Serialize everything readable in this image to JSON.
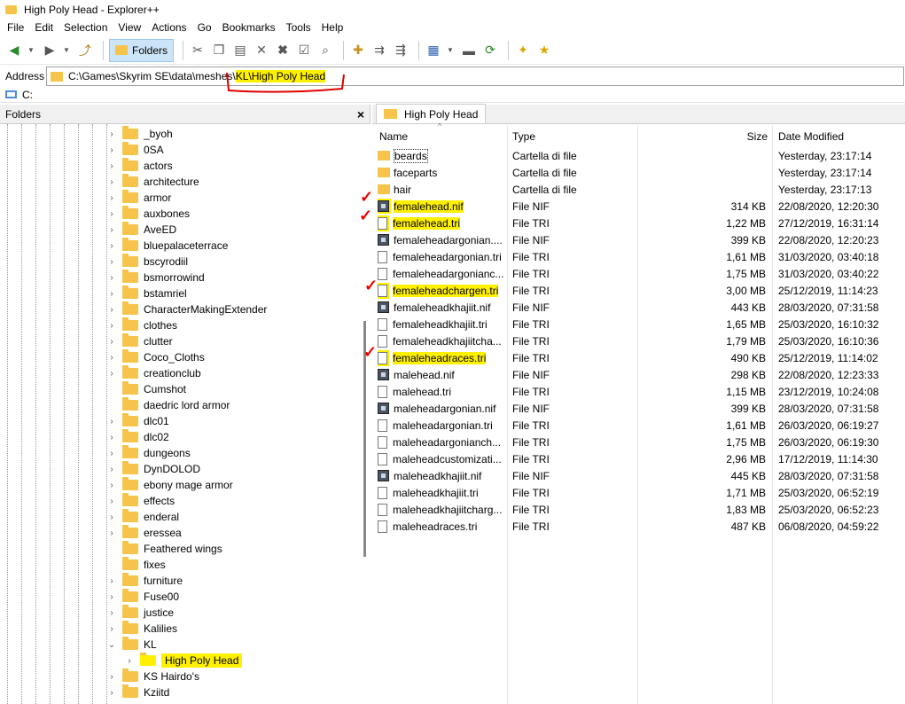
{
  "window": {
    "title": "High Poly Head - Explorer++"
  },
  "menu": [
    "File",
    "Edit",
    "Selection",
    "View",
    "Actions",
    "Go",
    "Bookmarks",
    "Tools",
    "Help"
  ],
  "toolbar": {
    "folders_label": "Folders"
  },
  "address": {
    "label": "Address",
    "path_prefix": "C:\\Games\\Skyrim SE\\data\\meshes\\",
    "path_highlight": "KL\\High Poly Head"
  },
  "drive": {
    "label": "C:"
  },
  "folders_pane": {
    "title": "Folders",
    "close": "×"
  },
  "tree": [
    {
      "label": "_byoh",
      "arrow": "›"
    },
    {
      "label": "0SA",
      "arrow": "›"
    },
    {
      "label": "actors",
      "arrow": "›"
    },
    {
      "label": "architecture",
      "arrow": "›"
    },
    {
      "label": "armor",
      "arrow": "›"
    },
    {
      "label": "auxbones",
      "arrow": "›"
    },
    {
      "label": "AveED",
      "arrow": "›"
    },
    {
      "label": "bluepalaceterrace",
      "arrow": "›"
    },
    {
      "label": "bscyrodiil",
      "arrow": "›"
    },
    {
      "label": "bsmorrowind",
      "arrow": "›"
    },
    {
      "label": "bstamriel",
      "arrow": "›"
    },
    {
      "label": "CharacterMakingExtender",
      "arrow": "›"
    },
    {
      "label": "clothes",
      "arrow": "›"
    },
    {
      "label": "clutter",
      "arrow": "›"
    },
    {
      "label": "Coco_Cloths",
      "arrow": "›"
    },
    {
      "label": "creationclub",
      "arrow": "›"
    },
    {
      "label": "Cumshot",
      "arrow": ""
    },
    {
      "label": "daedric lord armor",
      "arrow": ""
    },
    {
      "label": "dlc01",
      "arrow": "›"
    },
    {
      "label": "dlc02",
      "arrow": "›"
    },
    {
      "label": "dungeons",
      "arrow": "›"
    },
    {
      "label": "DynDOLOD",
      "arrow": "›"
    },
    {
      "label": "ebony mage armor",
      "arrow": "›"
    },
    {
      "label": "effects",
      "arrow": "›"
    },
    {
      "label": "enderal",
      "arrow": "›"
    },
    {
      "label": "eressea",
      "arrow": "›"
    },
    {
      "label": "Feathered wings",
      "arrow": ""
    },
    {
      "label": "fixes",
      "arrow": ""
    },
    {
      "label": "furniture",
      "arrow": "›"
    },
    {
      "label": "Fuse00",
      "arrow": "›"
    },
    {
      "label": "justice",
      "arrow": "›"
    },
    {
      "label": "Kalilies",
      "arrow": "›"
    },
    {
      "label": "KL",
      "arrow": "⌄"
    },
    {
      "label": "High Poly Head",
      "arrow": "›"
    },
    {
      "label": "KS Hairdo's",
      "arrow": "›"
    },
    {
      "label": "Kziitd",
      "arrow": "›"
    }
  ],
  "tab": {
    "label": "High Poly Head"
  },
  "columns": {
    "name": "Name",
    "type": "Type",
    "size": "Size",
    "date": "Date Modified"
  },
  "files": [
    {
      "name": "beards",
      "type": "Cartella di file",
      "size": "",
      "date": "Yesterday, 23:17:14",
      "icon": "folder"
    },
    {
      "name": "faceparts",
      "type": "Cartella di file",
      "size": "",
      "date": "Yesterday, 23:17:14",
      "icon": "folder"
    },
    {
      "name": "hair",
      "type": "Cartella di file",
      "size": "",
      "date": "Yesterday, 23:17:13",
      "icon": "folder"
    },
    {
      "name": "femalehead.nif",
      "type": "File NIF",
      "size": "314 KB",
      "date": "22/08/2020, 12:20:30",
      "icon": "nif"
    },
    {
      "name": "femalehead.tri",
      "type": "File TRI",
      "size": "1,22 MB",
      "date": "27/12/2019, 16:31:14",
      "icon": "doc"
    },
    {
      "name": "femaleheadargonian....",
      "type": "File NIF",
      "size": "399 KB",
      "date": "22/08/2020, 12:20:23",
      "icon": "nif"
    },
    {
      "name": "femaleheadargonian.tri",
      "type": "File TRI",
      "size": "1,61 MB",
      "date": "31/03/2020, 03:40:18",
      "icon": "doc"
    },
    {
      "name": "femaleheadargonianc...",
      "type": "File TRI",
      "size": "1,75 MB",
      "date": "31/03/2020, 03:40:22",
      "icon": "doc"
    },
    {
      "name": "femaleheadchargen.tri",
      "type": "File TRI",
      "size": "3,00 MB",
      "date": "25/12/2019, 11:14:23",
      "icon": "doc"
    },
    {
      "name": "femaleheadkhajiit.nif",
      "type": "File NIF",
      "size": "443 KB",
      "date": "28/03/2020, 07:31:58",
      "icon": "nif"
    },
    {
      "name": "femaleheadkhajiit.tri",
      "type": "File TRI",
      "size": "1,65 MB",
      "date": "25/03/2020, 16:10:32",
      "icon": "doc"
    },
    {
      "name": "femaleheadkhajiitcha...",
      "type": "File TRI",
      "size": "1,79 MB",
      "date": "25/03/2020, 16:10:36",
      "icon": "doc"
    },
    {
      "name": "femaleheadraces.tri",
      "type": "File TRI",
      "size": "490 KB",
      "date": "25/12/2019, 11:14:02",
      "icon": "doc"
    },
    {
      "name": "malehead.nif",
      "type": "File NIF",
      "size": "298 KB",
      "date": "22/08/2020, 12:23:33",
      "icon": "nif"
    },
    {
      "name": "malehead.tri",
      "type": "File TRI",
      "size": "1,15 MB",
      "date": "23/12/2019, 10:24:08",
      "icon": "doc"
    },
    {
      "name": "maleheadargonian.nif",
      "type": "File NIF",
      "size": "399 KB",
      "date": "28/03/2020, 07:31:58",
      "icon": "nif"
    },
    {
      "name": "maleheadargonian.tri",
      "type": "File TRI",
      "size": "1,61 MB",
      "date": "26/03/2020, 06:19:27",
      "icon": "doc"
    },
    {
      "name": "maleheadargonianch...",
      "type": "File TRI",
      "size": "1,75 MB",
      "date": "26/03/2020, 06:19:30",
      "icon": "doc"
    },
    {
      "name": "maleheadcustomizati...",
      "type": "File TRI",
      "size": "2,96 MB",
      "date": "17/12/2019, 11:14:30",
      "icon": "doc"
    },
    {
      "name": "maleheadkhajiit.nif",
      "type": "File NIF",
      "size": "445 KB",
      "date": "28/03/2020, 07:31:58",
      "icon": "nif"
    },
    {
      "name": "maleheadkhajiit.tri",
      "type": "File TRI",
      "size": "1,71 MB",
      "date": "25/03/2020, 06:52:19",
      "icon": "doc"
    },
    {
      "name": "maleheadkhajiitcharg...",
      "type": "File TRI",
      "size": "1,83 MB",
      "date": "25/03/2020, 06:52:23",
      "icon": "doc"
    },
    {
      "name": "maleheadraces.tri",
      "type": "File TRI",
      "size": "487 KB",
      "date": "06/08/2020, 04:59:22",
      "icon": "doc"
    }
  ],
  "highlighted_files": [
    "femalehead.nif",
    "femalehead.tri",
    "femaleheadchargen.tri",
    "femaleheadraces.tri"
  ],
  "colors": {
    "highlight": "#fff000",
    "annotation": "#e00000",
    "folder": "#f6c44a",
    "selection": "#cce4f7"
  }
}
